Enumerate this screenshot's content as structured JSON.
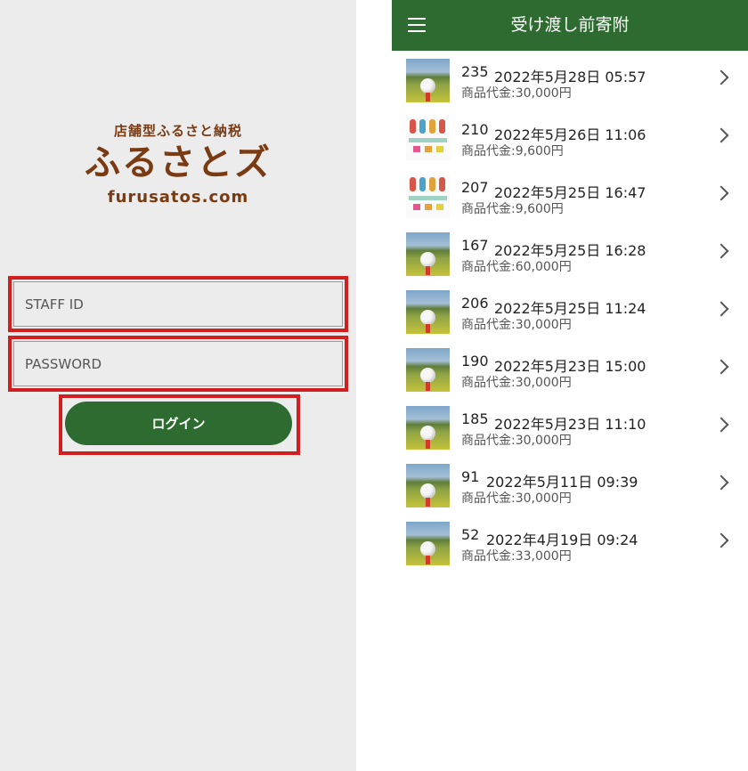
{
  "login": {
    "logo_sub": "店舗型ふるさと納税",
    "logo_main": "ふるさとズ",
    "logo_domain": "furusatos.com",
    "staff_id_placeholder": "STAFF ID",
    "password_placeholder": "PASSWORD",
    "login_label": "ログイン"
  },
  "list_screen": {
    "menu_icon": "hamburger-menu-icon",
    "title": "受け渡し前寄附",
    "items": [
      {
        "id": "235",
        "date": "2022年5月28日 05:57",
        "price": "商品代金:30,000円",
        "thumb": "golf"
      },
      {
        "id": "210",
        "date": "2022年5月26日 11:06",
        "price": "商品代金:9,600円",
        "thumb": "gift"
      },
      {
        "id": "207",
        "date": "2022年5月25日 16:47",
        "price": "商品代金:9,600円",
        "thumb": "gift"
      },
      {
        "id": "167",
        "date": "2022年5月25日 16:28",
        "price": "商品代金:60,000円",
        "thumb": "golf"
      },
      {
        "id": "206",
        "date": "2022年5月25日 11:24",
        "price": "商品代金:30,000円",
        "thumb": "golf"
      },
      {
        "id": "190",
        "date": "2022年5月23日 15:00",
        "price": "商品代金:30,000円",
        "thumb": "golf"
      },
      {
        "id": "185",
        "date": "2022年5月23日 11:10",
        "price": "商品代金:30,000円",
        "thumb": "golf"
      },
      {
        "id": "91",
        "date": "2022年5月11日 09:39",
        "price": "商品代金:30,000円",
        "thumb": "golf"
      },
      {
        "id": "52",
        "date": "2022年4月19日 09:24",
        "price": "商品代金:33,000円",
        "thumb": "golf"
      }
    ]
  },
  "colors": {
    "brand_green": "#2e6b30",
    "logo_brown": "#7a3b12",
    "highlight_red": "#d11f1f"
  }
}
